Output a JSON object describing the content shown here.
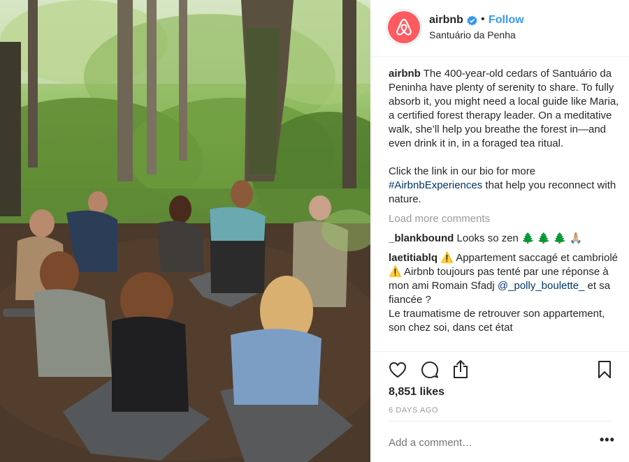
{
  "photo": {
    "description_icon": "forest-meditation-photo"
  },
  "header": {
    "username": "airbnb",
    "separator": "•",
    "follow_label": "Follow",
    "location": "Santuário da Penha"
  },
  "caption": {
    "username": "airbnb",
    "text_1": " The 400-year-old cedars of Santuário da Peninha have plenty of serenity to share. To fully absorb it, you might need a local guide like Maria, a certified forest therapy leader. On a meditative walk, she’ll help you breathe the forest in—and even drink it in, in a foraged tea ritual.",
    "text_2_before": "Click the link in our bio for more ",
    "hashtag": "#AirbnbExperiences",
    "text_2_after": " that help you reconnect with nature."
  },
  "load_more": "Load more comments",
  "comments": [
    {
      "username": "_blankbound",
      "text": " Looks so zen 🌲 🌲 🌲 🙏🏼"
    },
    {
      "username": "laetitiablq",
      "text_a": " ⚠️  Appartement saccagé et cambriolé ⚠️  Airbnb toujours pas tenté par une réponse à mon ami Romain Sfadj ",
      "mention": "@_polly_boulette_",
      "text_b": " et sa fiancée ?",
      "text_c": "Le traumatisme de retrouver son appartement, son chez soi, dans cet état"
    }
  ],
  "actions": {
    "like_icon": "heart-icon",
    "comment_icon": "comment-icon",
    "share_icon": "share-icon",
    "save_icon": "bookmark-icon"
  },
  "likes": "8,851 likes",
  "timestamp": "6 DAYS AGO",
  "add_comment_placeholder": "Add a comment…",
  "more_label": "•••",
  "colors": {
    "brand": "#ff5a5f",
    "link": "#3897f0",
    "hashtag": "#003569",
    "muted": "#999999"
  }
}
